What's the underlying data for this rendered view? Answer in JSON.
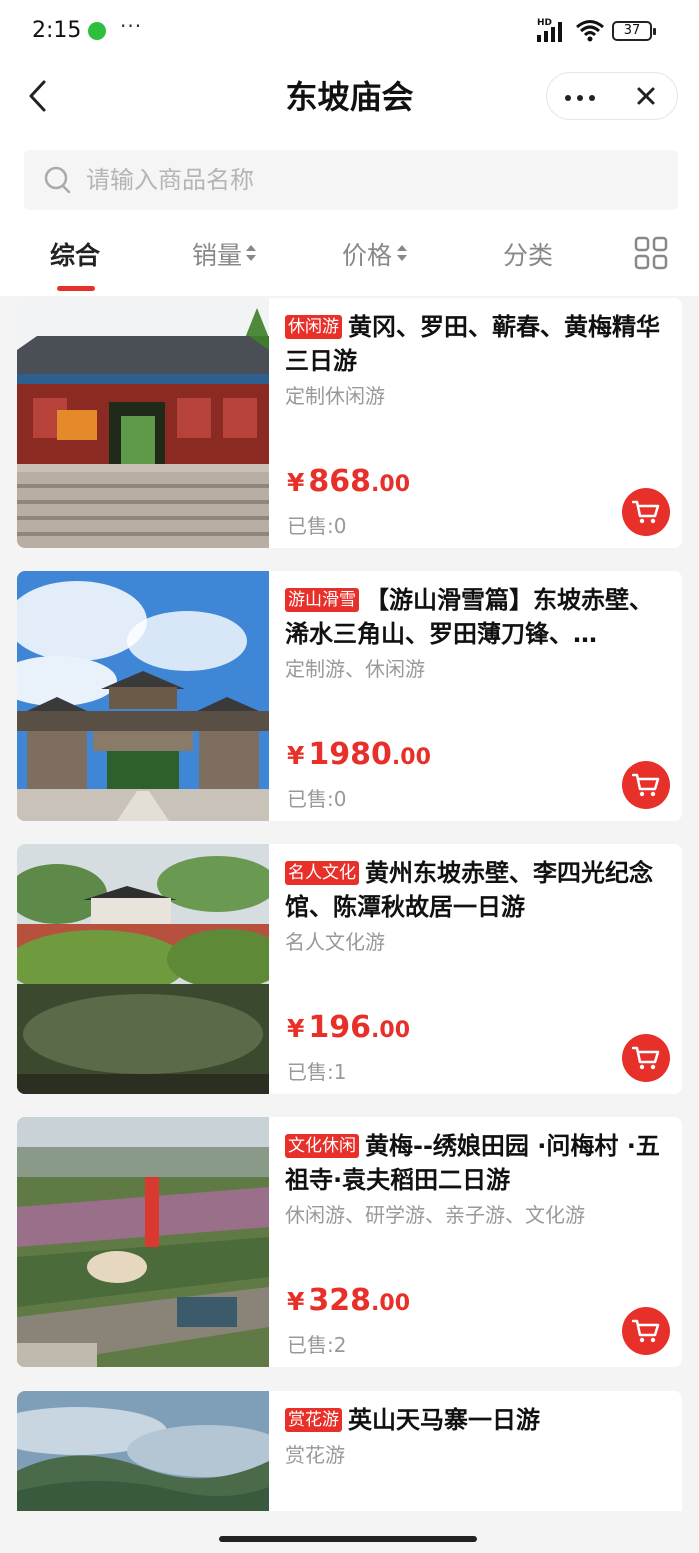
{
  "status_bar": {
    "time": "2:15",
    "more": "···",
    "network": "HD",
    "battery": "37"
  },
  "header": {
    "title": "东坡庙会"
  },
  "search": {
    "placeholder": "请输入商品名称"
  },
  "tabs": [
    {
      "label": "综合",
      "active": true
    },
    {
      "label": "销量",
      "sortable": true
    },
    {
      "label": "价格",
      "sortable": true
    },
    {
      "label": "分类"
    }
  ],
  "colors": {
    "accent": "#e8302a",
    "muted": "#999999",
    "background": "#f4f4f4"
  },
  "products": [
    {
      "tag": "休闲游",
      "title": "黄冈、罗田、蕲春、黄梅精华三日游",
      "subtitle": "定制休闲游",
      "currency": "¥",
      "price_int": "868",
      "price_dec": ".00",
      "sold": "已售:0"
    },
    {
      "tag": "游山滑雪",
      "title": "【游山滑雪篇】东坡赤壁、浠水三角山、罗田薄刀锋、…",
      "subtitle": "定制游、休闲游",
      "currency": "¥",
      "price_int": "1980",
      "price_dec": ".00",
      "sold": "已售:0"
    },
    {
      "tag": "名人文化",
      "title": "黄州东坡赤壁、李四光纪念馆、陈潭秋故居一日游",
      "subtitle": "名人文化游",
      "currency": "¥",
      "price_int": "196",
      "price_dec": ".00",
      "sold": "已售:1"
    },
    {
      "tag": "文化休闲",
      "title": "黄梅--绣娘田园 ·问梅村 ·五祖寺·袁夫稻田二日游",
      "subtitle": "休闲游、研学游、亲子游、文化游",
      "currency": "¥",
      "price_int": "328",
      "price_dec": ".00",
      "sold": "已售:2"
    },
    {
      "tag": "赏花游",
      "title": "英山天马寨一日游",
      "subtitle": "赏花游"
    }
  ]
}
